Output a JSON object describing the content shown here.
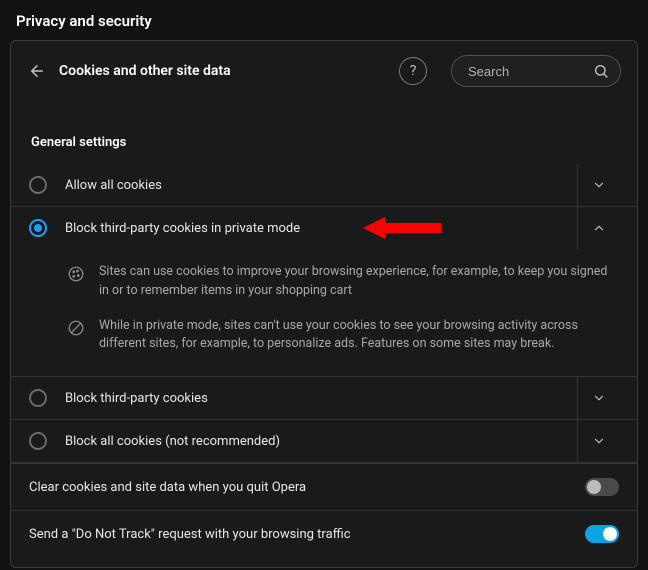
{
  "page_title": "Privacy and security",
  "panel": {
    "title": "Cookies and other site data",
    "search_placeholder": "Search"
  },
  "section_title": "General settings",
  "options": [
    {
      "label": "Allow all cookies",
      "selected": false,
      "expanded": false
    },
    {
      "label": "Block third-party cookies in private mode",
      "selected": true,
      "expanded": true,
      "details": [
        "Sites can use cookies to improve your browsing experience, for example, to keep you signed in or to remember items in your shopping cart",
        "While in private mode, sites can't use your cookies to see your browsing activity across different sites, for example, to personalize ads. Features on some sites may break."
      ]
    },
    {
      "label": "Block third-party cookies",
      "selected": false,
      "expanded": false
    },
    {
      "label": "Block all cookies (not recommended)",
      "selected": false,
      "expanded": false
    }
  ],
  "settings": [
    {
      "label": "Clear cookies and site data when you quit Opera",
      "on": false
    },
    {
      "label": "Send a \"Do Not Track\" request with your browsing traffic",
      "on": true
    }
  ]
}
